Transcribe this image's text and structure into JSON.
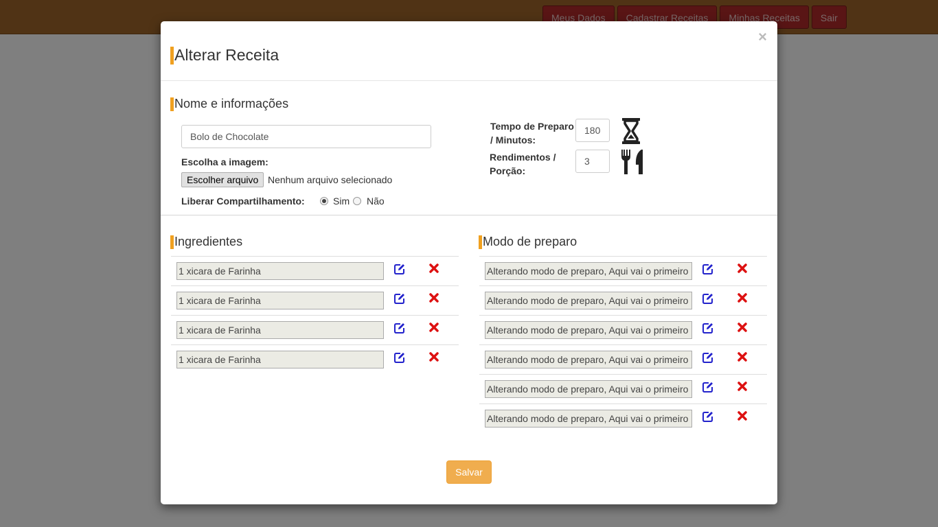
{
  "nav": {
    "items": [
      "Meus Dados",
      "Cadastrar Receitas",
      "Minhas Receitas",
      "Sair"
    ]
  },
  "modal": {
    "title": "Alterar Receita",
    "close": "×",
    "save_label": "Salvar"
  },
  "info": {
    "section_title": "Nome e informações",
    "name_value": "Bolo de Chocolate",
    "image_label": "Escolha a imagem:",
    "file_button": "Escolher arquivo",
    "file_status": "Nenhum arquivo selecionado",
    "share_label": "Liberar Compartilhamento:",
    "share_yes": "Sim",
    "share_no": "Não",
    "share_selected": "Sim",
    "time_label": "Tempo de Preparo / Minutos:",
    "time_value": "180",
    "yield_label": "Rendimentos / Porção:",
    "yield_value": "3",
    "time_icon": "hourglass-icon",
    "yield_icon": "fork-knife-icon"
  },
  "ingredients": {
    "section_title": "Ingredientes",
    "items": [
      "1 xicara de Farinha",
      "1 xicara de Farinha",
      "1 xicara de Farinha",
      "1 xicara de Farinha"
    ]
  },
  "steps": {
    "section_title": "Modo de preparo",
    "items": [
      "Alterando modo de preparo, Aqui vai o primeiro",
      "Alterando modo de preparo, Aqui vai o primeiro",
      "Alterando modo de preparo, Aqui vai o primeiro",
      "Alterando modo de preparo, Aqui vai o primeiro",
      "Alterando modo de preparo, Aqui vai o primeiro",
      "Alterando modo de preparo, Aqui vai o primeiro"
    ]
  },
  "colors": {
    "accent": "#f0a020",
    "edit": "#2222cc",
    "delete": "#dd1111",
    "save": "#f0ad4e",
    "topbar": "#a0672a",
    "nav_button": "#b32a2a"
  }
}
